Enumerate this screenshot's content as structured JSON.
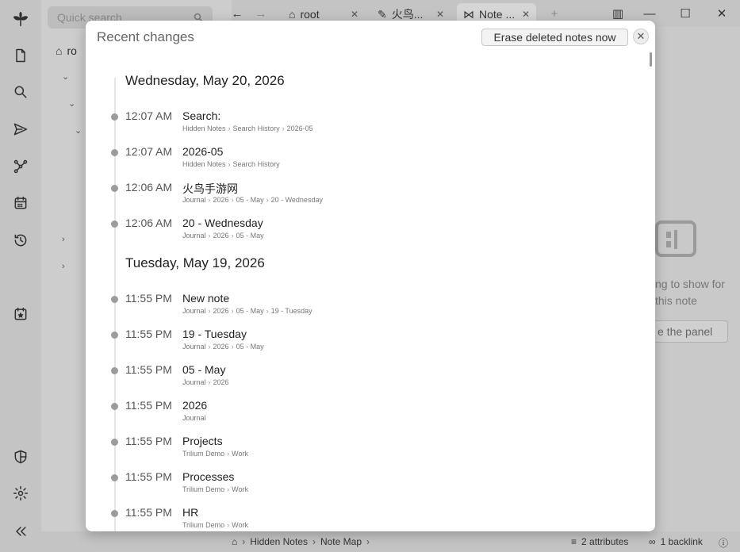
{
  "launcher": {
    "items": [
      "new-note",
      "search",
      "jump-to",
      "note-map",
      "calendar",
      "recent-changes",
      "today",
      "protected-session",
      "settings",
      "collapse"
    ]
  },
  "tree": {
    "search_placeholder": "Quick search",
    "root_label": "ro"
  },
  "tabs": [
    {
      "label": "root"
    },
    {
      "label": "火鸟..."
    },
    {
      "label": "Note ..."
    }
  ],
  "side_panel": {
    "empty_text_line1": "ng to show for",
    "empty_text_line2": "this note",
    "button_label": "e the panel"
  },
  "statusbar": {
    "crumb1": "Hidden Notes",
    "crumb2": "Note Map",
    "attributes": "2 attributes",
    "backlinks": "1 backlink"
  },
  "dialog": {
    "title": "Recent changes",
    "erase_button": "Erase deleted notes now",
    "days": [
      {
        "date": "Wednesday, May 20, 2026",
        "entries": [
          {
            "time": "12:07 AM",
            "title": "Search:",
            "path": [
              "Hidden Notes",
              "Search History",
              "2026-05"
            ]
          },
          {
            "time": "12:07 AM",
            "title": "2026-05",
            "path": [
              "Hidden Notes",
              "Search History"
            ]
          },
          {
            "time": "12:06 AM",
            "title": "火鸟手游网",
            "path": [
              "Journal",
              "2026",
              "05 - May",
              "20 - Wednesday"
            ]
          },
          {
            "time": "12:06 AM",
            "title": "20 - Wednesday",
            "path": [
              "Journal",
              "2026",
              "05 - May"
            ]
          }
        ]
      },
      {
        "date": "Tuesday, May 19, 2026",
        "entries": [
          {
            "time": "11:55 PM",
            "title": "New note",
            "path": [
              "Journal",
              "2026",
              "05 - May",
              "19 - Tuesday"
            ]
          },
          {
            "time": "11:55 PM",
            "title": "19 - Tuesday",
            "path": [
              "Journal",
              "2026",
              "05 - May"
            ]
          },
          {
            "time": "11:55 PM",
            "title": "05 - May",
            "path": [
              "Journal",
              "2026"
            ]
          },
          {
            "time": "11:55 PM",
            "title": "2026",
            "path": [
              "Journal"
            ]
          },
          {
            "time": "11:55 PM",
            "title": "Projects",
            "path": [
              "Trilium Demo",
              "Work"
            ]
          },
          {
            "time": "11:55 PM",
            "title": "Processes",
            "path": [
              "Trilium Demo",
              "Work"
            ]
          },
          {
            "time": "11:55 PM",
            "title": "HR",
            "path": [
              "Trilium Demo",
              "Work"
            ]
          }
        ]
      }
    ]
  }
}
